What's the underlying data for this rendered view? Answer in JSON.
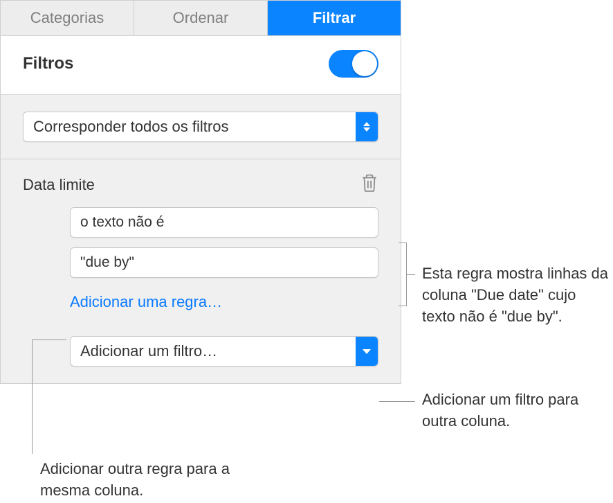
{
  "tabs": {
    "categories": "Categorias",
    "sort": "Ordenar",
    "filter": "Filtrar"
  },
  "header": {
    "title": "Filtros"
  },
  "match_select": {
    "label": "Corresponder todos os filtros"
  },
  "rule": {
    "title": "Data limite",
    "condition_value": "o texto não é",
    "text_value": "\"due by\"",
    "add_rule_label": "Adicionar uma regra…"
  },
  "add_filter": {
    "label": "Adicionar um filtro…"
  },
  "callouts": {
    "rule_desc": "Esta regra mostra linhas da coluna \"Due date\" cujo texto não é \"due by\".",
    "add_filter_desc": "Adicionar um filtro para outra coluna.",
    "add_rule_desc": "Adicionar outra regra para a mesma coluna."
  }
}
